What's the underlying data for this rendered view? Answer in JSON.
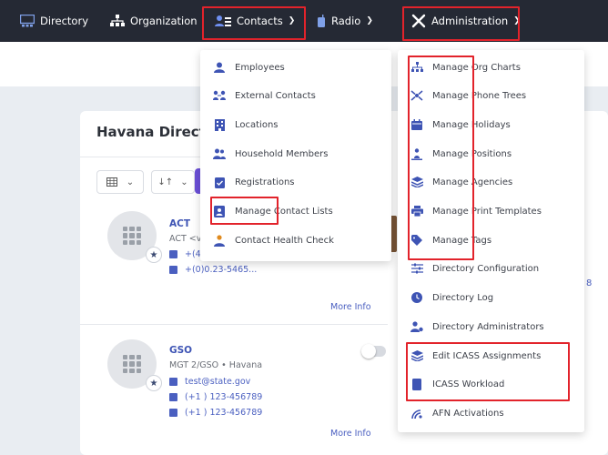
{
  "nav": {
    "directory": "Directory",
    "organization": "Organization",
    "contacts": "Contacts",
    "radio": "Radio",
    "administration": "Administration"
  },
  "card": {
    "title": "Havana Directo",
    "more_info": "More Info"
  },
  "contacts": [
    {
      "name": "ACT",
      "subtitle": "ACT <v",
      "phone1": "+(4",
      "phone2": "+(0)0.23-5465..."
    },
    {
      "name": "GSO",
      "subtitle": "MGT 2/GSO • Havana",
      "email": "test@state.gov",
      "phone1": "(+1 ) 123-456789",
      "phone2": "(+1 ) 123-456789"
    }
  ],
  "side_number": "8",
  "contacts_menu": [
    {
      "label": "Employees",
      "icon": "person-icon"
    },
    {
      "label": "External Contacts",
      "icon": "linked-people-icon"
    },
    {
      "label": "Locations",
      "icon": "building-icon"
    },
    {
      "label": "Household Members",
      "icon": "group-icon"
    },
    {
      "label": "Registrations",
      "icon": "clipboard-check-icon"
    },
    {
      "label": "Manage Contact Lists",
      "icon": "contact-card-icon"
    },
    {
      "label": "Contact Health Check",
      "icon": "health-person-icon"
    }
  ],
  "admin_menu": [
    {
      "label": "Manage Org Charts",
      "icon": "org-chart-icon"
    },
    {
      "label": "Manage Phone Trees",
      "icon": "phone-tree-icon"
    },
    {
      "label": "Manage Holidays",
      "icon": "calendar-icon"
    },
    {
      "label": "Manage Positions",
      "icon": "position-icon"
    },
    {
      "label": "Manage Agencies",
      "icon": "layers-icon"
    },
    {
      "label": "Manage Print Templates",
      "icon": "printer-icon"
    },
    {
      "label": "Manage Tags",
      "icon": "tag-icon"
    },
    {
      "label": "Directory Configuration",
      "icon": "sliders-icon"
    },
    {
      "label": "Directory Log",
      "icon": "clock-icon"
    },
    {
      "label": "Directory Administrators",
      "icon": "admin-user-icon"
    },
    {
      "label": "Edit ICASS Assignments",
      "icon": "layers-icon"
    },
    {
      "label": "ICASS Workload",
      "icon": "document-icon"
    },
    {
      "label": "AFN Activations",
      "icon": "satellite-icon"
    }
  ],
  "colors": {
    "nav_bg": "#252934",
    "accent": "#3e54b4",
    "highlight": "#e2232b"
  }
}
